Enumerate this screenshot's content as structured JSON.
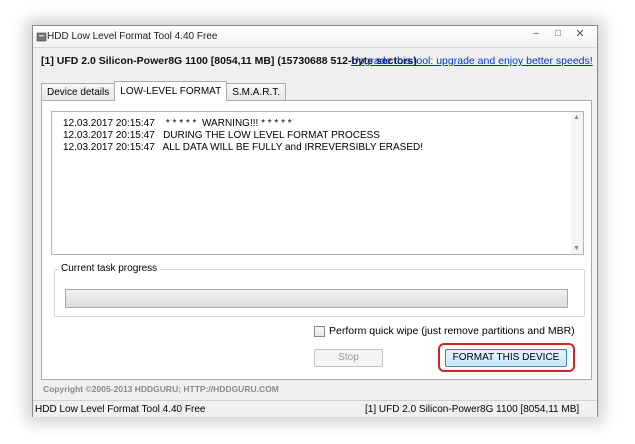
{
  "window": {
    "title": "HDD Low Level Format Tool 4.40   Free",
    "controls": {
      "minimize": "–",
      "maximize": "□",
      "close": "✕"
    }
  },
  "device_line": "[1]  UFD 2.0 Silicon-Power8G    1100    [8054,11 MB]    (15730688 512-byte sectors)",
  "promo_link": "Upgrade this tool: upgrade and enjoy better speeds!",
  "tabs": [
    {
      "label": "Device details",
      "active": false
    },
    {
      "label": "LOW-LEVEL FORMAT",
      "active": true
    },
    {
      "label": "S.M.A.R.T.",
      "active": false
    }
  ],
  "log": [
    "12.03.2017 20:15:47    * * * * *  WARNING!!! * * * * *",
    "12.03.2017 20:15:47   DURING THE LOW LEVEL FORMAT PROCESS",
    "12.03.2017 20:15:47   ALL DATA WILL BE FULLY and IRREVERSIBLY ERASED!"
  ],
  "progress": {
    "label": "Current task progress",
    "value": 0
  },
  "quick_wipe": {
    "label": "Perform quick wipe (just remove partitions and MBR)",
    "checked": false
  },
  "buttons": {
    "stop": "Stop",
    "format": "FORMAT THIS DEVICE"
  },
  "copyright": "Copyright ©2005-2013 HDDGURU;   HTTP://HDDGURU.COM",
  "status": {
    "left": "HDD Low Level Format Tool 4.40   Free",
    "right": "[1]  UFD 2.0 Silicon-Power8G    1100    [8054,11 MB]"
  },
  "colors": {
    "highlight": "#c8292b",
    "link": "#0033cc"
  }
}
